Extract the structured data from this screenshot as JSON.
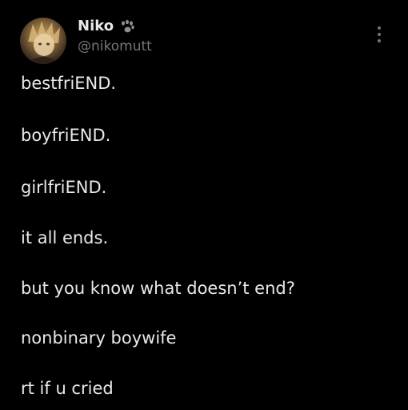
{
  "author": {
    "display_name": "Niko",
    "handle": "@nikomutt",
    "badge_icon": "paw-print-icon",
    "avatar_icon": "profile-avatar"
  },
  "menu": {
    "icon": "more-options-icon"
  },
  "tweet": {
    "lines": [
      "bestfriEND.",
      "boyfriEND.",
      "girlfriEND.",
      "it all ends.",
      "but you know what doesn’t end?",
      "nonbinary boywife",
      "rt if u cried"
    ]
  },
  "colors": {
    "background": "#000000",
    "text_primary": "#e7e9ea",
    "text_secondary": "#71767b"
  }
}
